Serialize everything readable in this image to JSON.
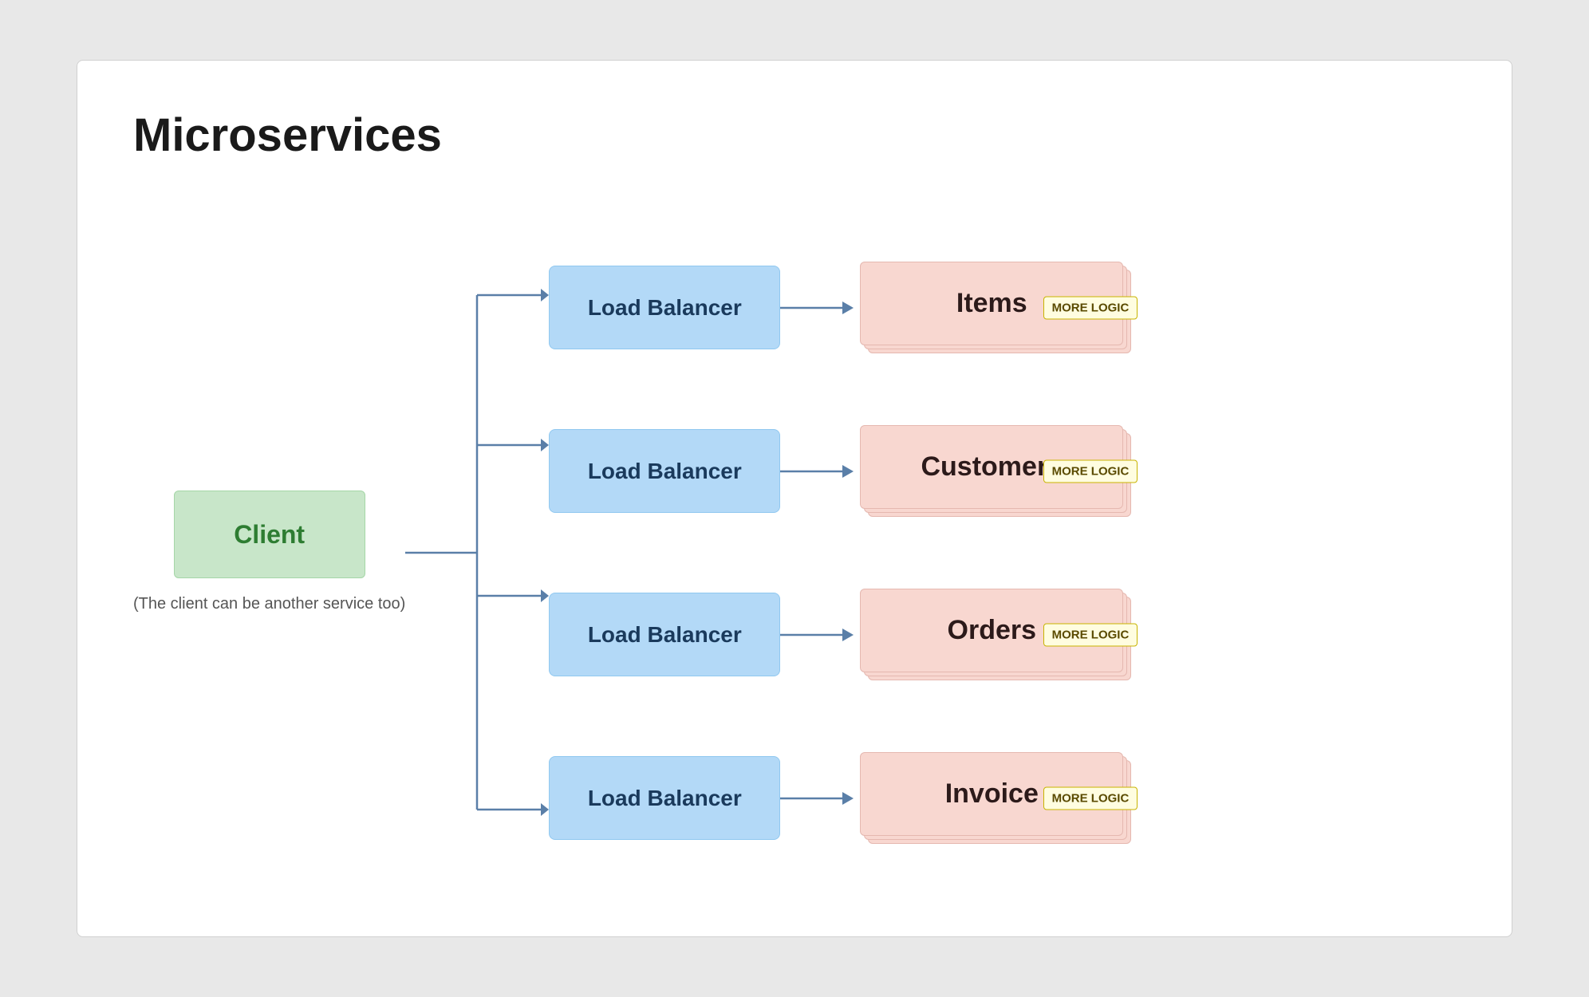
{
  "title": "Microservices",
  "client": {
    "label": "Client",
    "note": "(The client can be another service too)"
  },
  "load_balancer_label": "Load Balancer",
  "services": [
    {
      "name": "Items",
      "badge": "MORE LOGIC"
    },
    {
      "name": "Customers",
      "badge": "MORE LOGIC"
    },
    {
      "name": "Orders",
      "badge": "MORE LOGIC"
    },
    {
      "name": "Invoice",
      "badge": "MORE LOGIC"
    }
  ],
  "colors": {
    "client_bg": "#c8e6c9",
    "client_border": "#a5d6a7",
    "lb_bg": "#b3d9f7",
    "lb_border": "#90c8f0",
    "service_bg": "#f8d7d0",
    "service_border": "#e5b8b0",
    "badge_bg": "#fffde0",
    "badge_border": "#c8b400",
    "arrow": "#5a7fa8"
  }
}
